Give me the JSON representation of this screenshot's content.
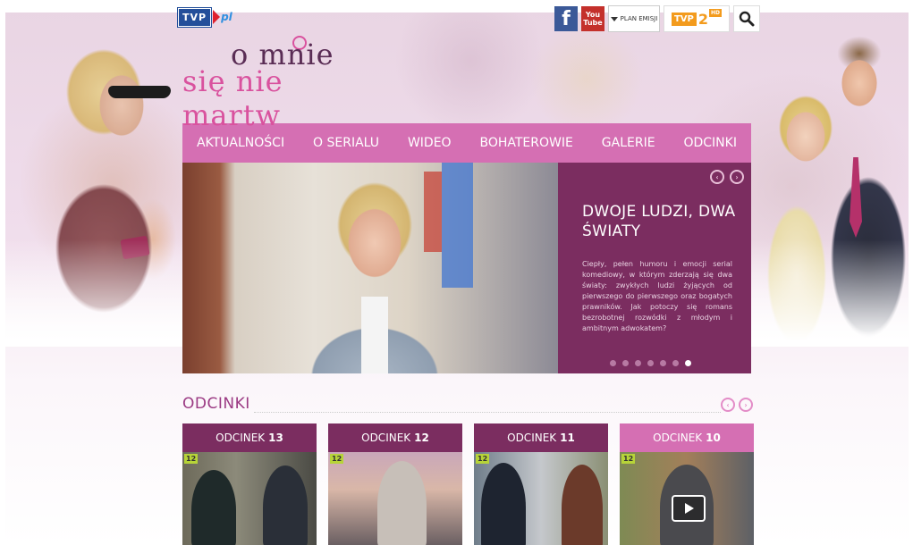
{
  "header": {
    "tvp_logo": "TVP",
    "tvp_pl": "pl",
    "show_title_line1": "o mnie",
    "show_title_line2": "się nie martw",
    "plan_emisji": "PLAN EMISJI",
    "tvp2_label": "TVP",
    "tvp2_number": "2",
    "tvp2_hd": "HD",
    "youtube_top": "You",
    "youtube_bottom": "Tube",
    "facebook": "f"
  },
  "nav": {
    "items": [
      "AKTUALNOŚCI",
      "O SERIALU",
      "WIDEO",
      "BOHATEROWIE",
      "GALERIE",
      "ODCINKI"
    ]
  },
  "hero": {
    "title": "DWOJE LUDZI, DWA ŚWIATY",
    "description": "Ciepły, pełen humoru i emocji serial komediowy, w którym zderzają się dwa światy: zwykłych ludzi żyjących od pierwszego do pierwszego oraz bogatych prawników. Jak potoczy się romans bezrobotnej rozwódki z młodym i ambitnym adwokatem?",
    "slide_count": 7,
    "active_slide": 7
  },
  "episodes": {
    "section_title": "ODCINKI",
    "items": [
      {
        "label": "ODCINEK",
        "number": "13",
        "age_badge": "12"
      },
      {
        "label": "ODCINEK",
        "number": "12",
        "age_badge": "12"
      },
      {
        "label": "ODCINEK",
        "number": "11",
        "age_badge": "12"
      },
      {
        "label": "ODCINEK",
        "number": "10",
        "age_badge": "12"
      }
    ]
  },
  "colors": {
    "nav_pink": "#d56fb3",
    "dark_plum": "#7b2d60",
    "title_plum": "#9b3a83"
  }
}
